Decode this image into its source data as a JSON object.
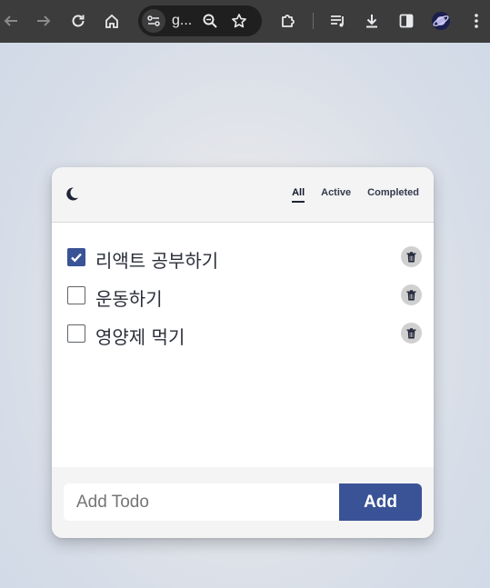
{
  "browser": {
    "url_text": "g...",
    "icons": [
      "back-icon",
      "forward-icon",
      "reload-icon",
      "home-icon",
      "site-info-icon",
      "zoom-icon",
      "bookmark-star-icon",
      "extensions-icon",
      "media-queue-icon",
      "download-icon",
      "side-panel-icon",
      "profile-icon",
      "menu-icon"
    ]
  },
  "app": {
    "theme_icon": "moon-icon",
    "filters": [
      {
        "label": "All",
        "active": true
      },
      {
        "label": "Active",
        "active": false
      },
      {
        "label": "Completed",
        "active": false
      }
    ],
    "todos": [
      {
        "text": "리액트 공부하기",
        "completed": true
      },
      {
        "text": "운동하기",
        "completed": false
      },
      {
        "text": "영양제 먹기",
        "completed": false
      }
    ],
    "input": {
      "placeholder": "Add Todo",
      "value": ""
    },
    "add_label": "Add",
    "colors": {
      "accent": "#3a5396",
      "header_bg": "#f4f4f4",
      "delete_bg": "#d0d0d0"
    }
  }
}
